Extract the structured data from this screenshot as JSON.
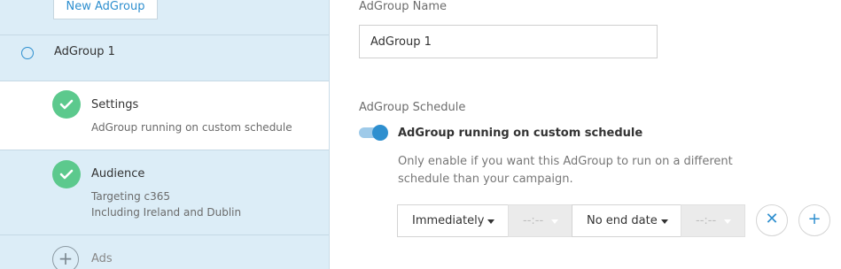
{
  "sidebar": {
    "new_adgroup_label": "New AdGroup",
    "adgroup_label": "AdGroup 1",
    "steps": [
      {
        "title": "Settings",
        "lines": [
          "AdGroup running on custom schedule"
        ]
      },
      {
        "title": "Audience",
        "lines": [
          "Targeting c365",
          "Including Ireland and Dublin"
        ]
      },
      {
        "title": "Ads"
      }
    ]
  },
  "main": {
    "name_label": "AdGroup Name",
    "name_value": "AdGroup 1",
    "schedule_label": "AdGroup Schedule",
    "toggle_label": "AdGroup running on custom schedule",
    "help_text": "Only enable if you want this AdGroup to run on a different schedule than your campaign.",
    "schedule": {
      "start": "Immediately",
      "start_time": "--:--",
      "end": "No end date",
      "end_time": "--:--"
    }
  },
  "colors": {
    "accent": "#2e8fcf",
    "check": "#5cc98d",
    "sidebar_bg": "#dcedf7"
  },
  "icons": {
    "check": "check-icon",
    "plus": "plus-icon",
    "close": "close-icon",
    "caret": "caret-down-icon"
  }
}
